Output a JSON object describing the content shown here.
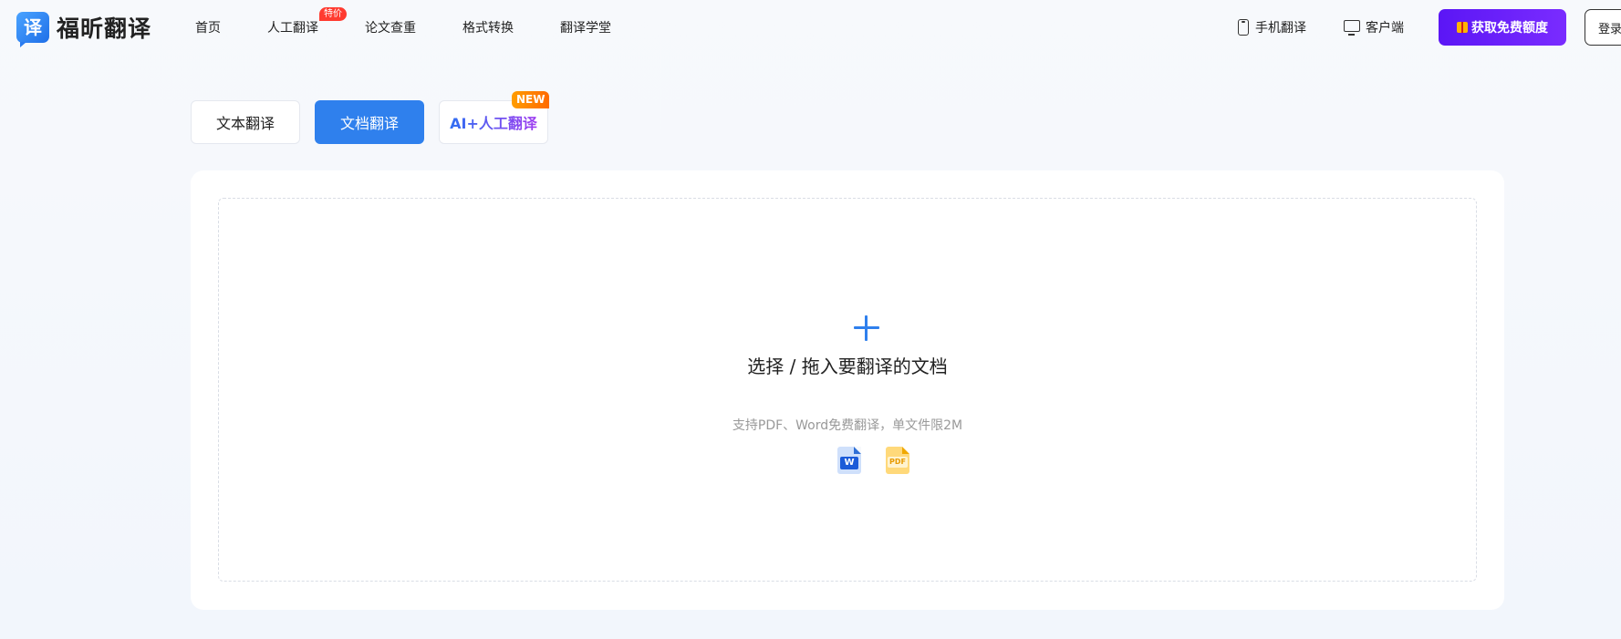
{
  "header": {
    "logo_glyph": "译",
    "logo_text": "福昕翻译",
    "nav": [
      "首页",
      "人工翻译",
      "论文查重",
      "格式转换",
      "翻译学堂"
    ],
    "nav_badge": "特价",
    "mobile_label": "手机翻译",
    "desktop_label": "客户端",
    "cta_label": "获取免费额度",
    "login_label": "登录"
  },
  "tabs": {
    "text": "文本翻译",
    "document": "文档翻译",
    "ai_human": "AI+人工翻译",
    "active": "文档翻译",
    "new_badge": "NEW"
  },
  "upload": {
    "title": "选择 / 拖入要翻译的文档",
    "hint": "支持PDF、Word免费翻译，单文件限2M",
    "word_label": "W",
    "pdf_label": "PDF"
  },
  "colors": {
    "primary": "#2f80ed",
    "cta": "#6a1ff8",
    "badge_hot": "#ff3b30",
    "badge_new": "#ff8a00"
  }
}
